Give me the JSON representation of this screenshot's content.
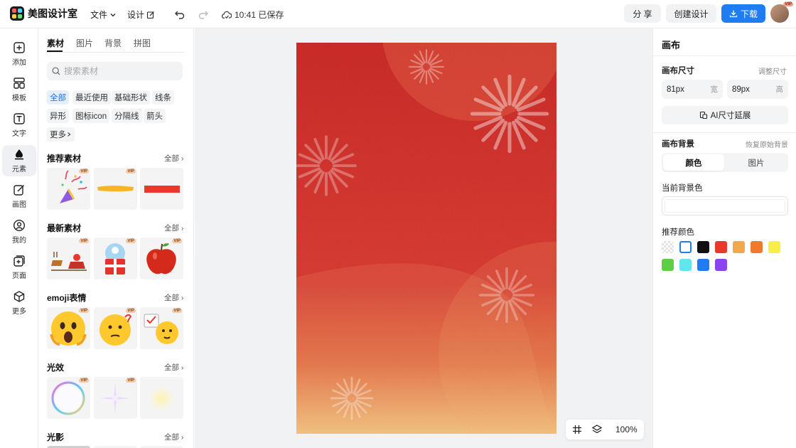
{
  "app": {
    "logo_text": "美图设计室",
    "menu_file": "文件",
    "menu_design": "设计",
    "save_status": "10:41 已保存",
    "share_label": "分 享",
    "create_label": "创建设计",
    "download_label": "下载",
    "avatar_badge": "VIP"
  },
  "leftnav": {
    "items": [
      {
        "label": "添加",
        "icon": "plus-square-icon"
      },
      {
        "label": "模板",
        "icon": "template-icon"
      },
      {
        "label": "文字",
        "icon": "text-icon"
      },
      {
        "label": "元素",
        "icon": "shapes-icon"
      },
      {
        "label": "画图",
        "icon": "draw-icon"
      },
      {
        "label": "我的",
        "icon": "user-icon"
      },
      {
        "label": "页面",
        "icon": "page-add-icon"
      },
      {
        "label": "更多",
        "icon": "cube-icon"
      }
    ],
    "active_index": 3
  },
  "panel": {
    "tabs": [
      "素材",
      "图片",
      "背景",
      "拼图"
    ],
    "active_tab": 0,
    "search_placeholder": "搜索素材",
    "chips": [
      "全部",
      "最近使用",
      "基础形状",
      "线条",
      "异形",
      "图标icon",
      "分隔线",
      "箭头"
    ],
    "more_label": "更多",
    "vip_label": "VIP",
    "sections": [
      {
        "title": "推荐素材",
        "all": "全部"
      },
      {
        "title": "最新素材",
        "all": "全部"
      },
      {
        "title": "emoji表情",
        "all": "全部"
      },
      {
        "title": "光效",
        "all": "全部"
      },
      {
        "title": "光影",
        "all": "全部"
      }
    ]
  },
  "workspace": {
    "zoom": "100%",
    "canvas_colors": {
      "top": "#cf2a25",
      "bottom": "#f2c27a"
    }
  },
  "rpanel": {
    "title": "画布",
    "size_label": "画布尺寸",
    "adjust_size": "调整尺寸",
    "width_value": "81px",
    "width_unit": "宽",
    "height_value": "89px",
    "height_unit": "高",
    "ai_extend": "AI尺寸延展",
    "bg_label": "画布背景",
    "restore_bg": "恢复原始背景",
    "seg_color": "颜色",
    "seg_image": "图片",
    "current_bg": "当前背景色",
    "recommend": "推荐颜色",
    "swatches": [
      "transparent",
      "#ffffff",
      "#111111",
      "#e8392a",
      "#f3a84e",
      "#ef7a2c",
      "#f7ee47",
      "#5ecf45",
      "#62e6ee",
      "#1f7cf2",
      "#8a44f2"
    ]
  }
}
